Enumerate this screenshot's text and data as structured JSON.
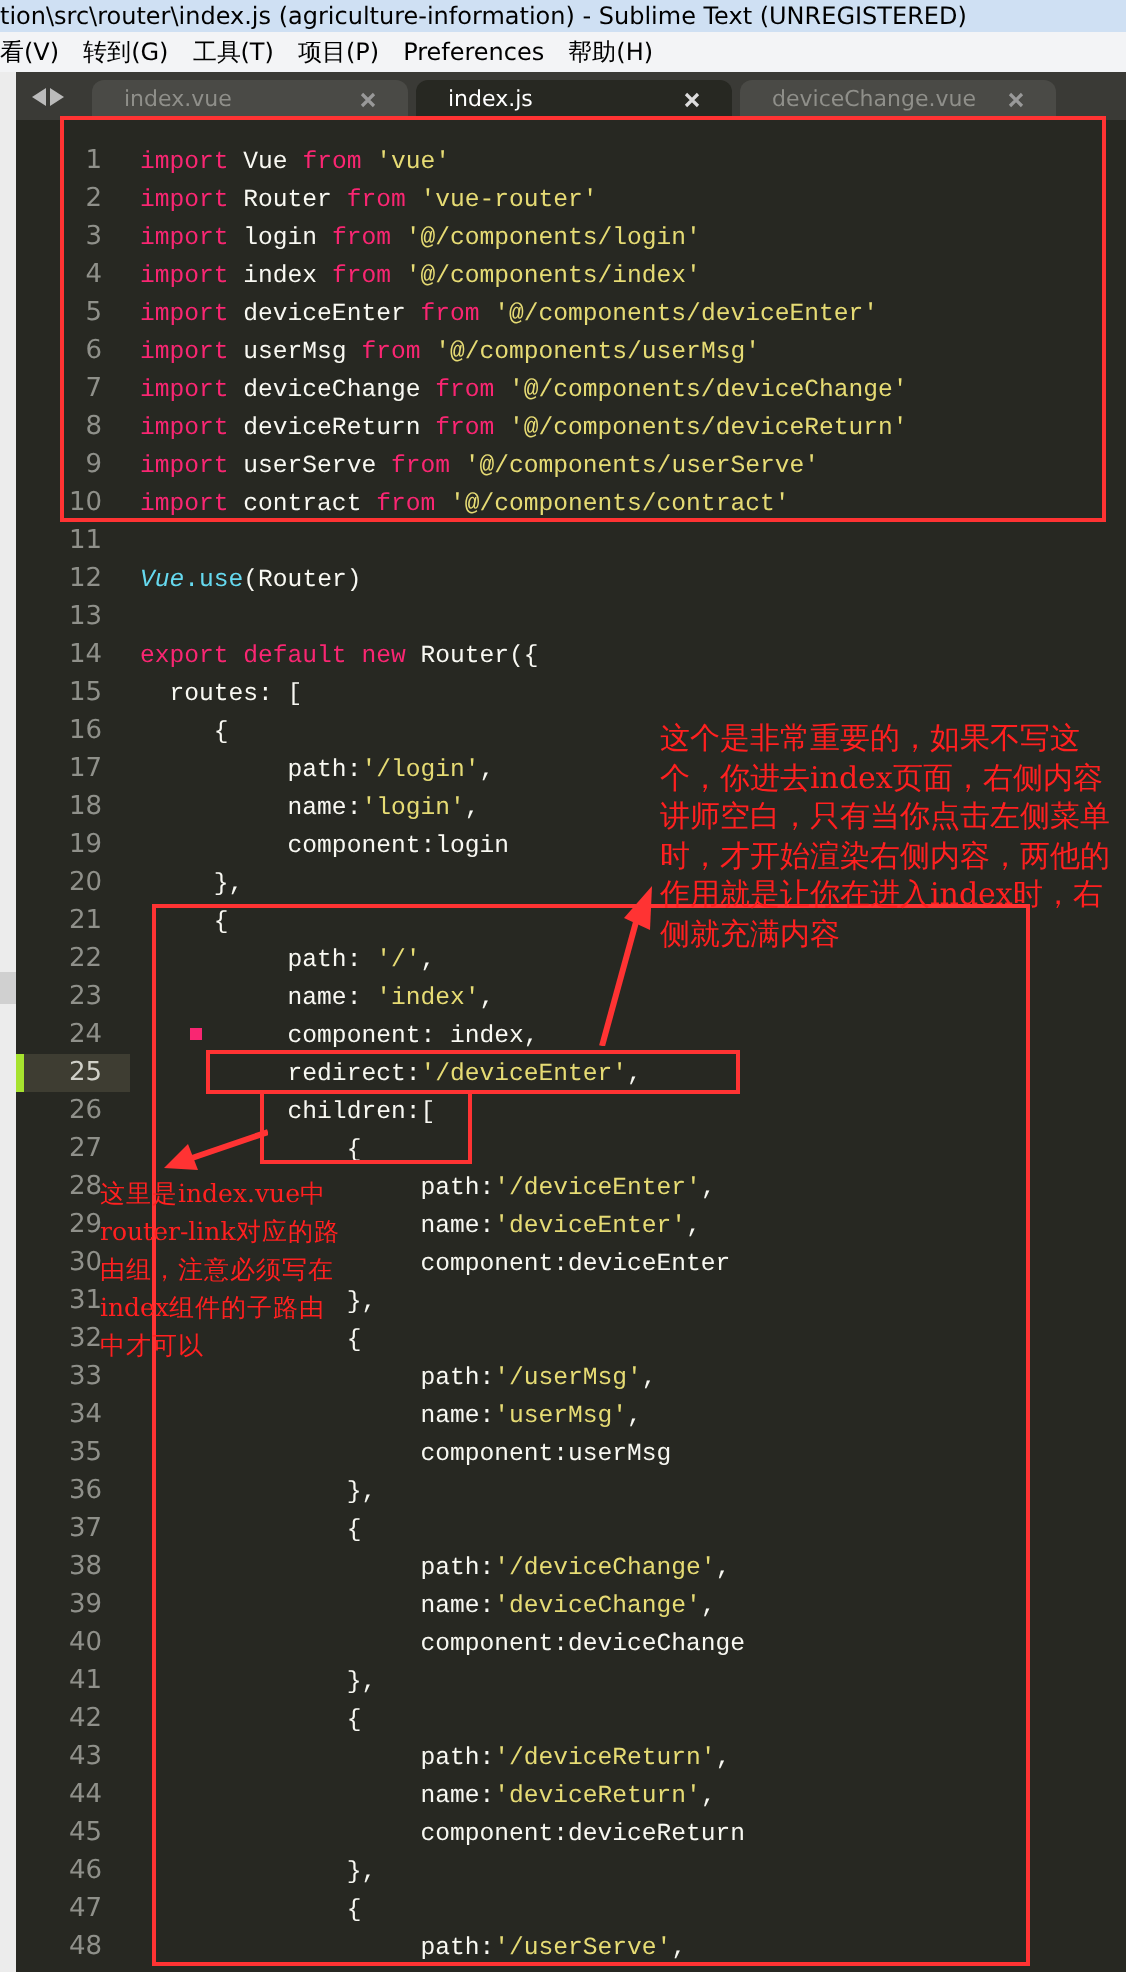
{
  "window": {
    "title": "tion\\src\\router\\index.js (agriculture-information) - Sublime Text (UNREGISTERED)"
  },
  "menu": [
    "看(V)",
    "转到(G)",
    "工具(T)",
    "项目(P)",
    "Preferences",
    "帮助(H)"
  ],
  "tabs": [
    {
      "label": "index.vue",
      "selected": false
    },
    {
      "label": "index.js",
      "selected": true
    },
    {
      "label": "deviceChange.vue",
      "selected": false
    }
  ],
  "editor": {
    "lines": [
      {
        "number": "1",
        "current": false,
        "tokens": [
          {
            "kind": "kw",
            "text": "import"
          },
          {
            "kind": "plain",
            "text": " Vue "
          },
          {
            "kind": "kw",
            "text": "from"
          },
          {
            "kind": "str",
            "text": " 'vue'"
          }
        ]
      },
      {
        "number": "2",
        "current": false,
        "tokens": [
          {
            "kind": "kw",
            "text": "import"
          },
          {
            "kind": "plain",
            "text": " Router "
          },
          {
            "kind": "kw",
            "text": "from"
          },
          {
            "kind": "str",
            "text": " 'vue-router'"
          }
        ]
      },
      {
        "number": "3",
        "current": false,
        "tokens": [
          {
            "kind": "kw",
            "text": "import"
          },
          {
            "kind": "plain",
            "text": " login "
          },
          {
            "kind": "kw",
            "text": "from"
          },
          {
            "kind": "str",
            "text": " '@/components/login'"
          }
        ]
      },
      {
        "number": "4",
        "current": false,
        "tokens": [
          {
            "kind": "kw",
            "text": "import"
          },
          {
            "kind": "plain",
            "text": " index "
          },
          {
            "kind": "kw",
            "text": "from"
          },
          {
            "kind": "str",
            "text": " '@/components/index'"
          }
        ]
      },
      {
        "number": "5",
        "current": false,
        "tokens": [
          {
            "kind": "kw",
            "text": "import"
          },
          {
            "kind": "plain",
            "text": " deviceEnter "
          },
          {
            "kind": "kw",
            "text": "from"
          },
          {
            "kind": "str",
            "text": " '@/components/deviceEnter'"
          }
        ]
      },
      {
        "number": "6",
        "current": false,
        "tokens": [
          {
            "kind": "kw",
            "text": "import"
          },
          {
            "kind": "plain",
            "text": " userMsg "
          },
          {
            "kind": "kw",
            "text": "from"
          },
          {
            "kind": "str",
            "text": " '@/components/userMsg'"
          }
        ]
      },
      {
        "number": "7",
        "current": false,
        "tokens": [
          {
            "kind": "kw",
            "text": "import"
          },
          {
            "kind": "plain",
            "text": " deviceChange "
          },
          {
            "kind": "kw",
            "text": "from"
          },
          {
            "kind": "str",
            "text": " '@/components/deviceChange'"
          }
        ]
      },
      {
        "number": "8",
        "current": false,
        "tokens": [
          {
            "kind": "kw",
            "text": "import"
          },
          {
            "kind": "plain",
            "text": " deviceReturn "
          },
          {
            "kind": "kw",
            "text": "from"
          },
          {
            "kind": "str",
            "text": " '@/components/deviceReturn'"
          }
        ]
      },
      {
        "number": "9",
        "current": false,
        "tokens": [
          {
            "kind": "kw",
            "text": "import"
          },
          {
            "kind": "plain",
            "text": " userServe "
          },
          {
            "kind": "kw",
            "text": "from"
          },
          {
            "kind": "str",
            "text": " '@/components/userServe'"
          }
        ]
      },
      {
        "number": "10",
        "current": false,
        "tokens": [
          {
            "kind": "kw",
            "text": "import"
          },
          {
            "kind": "plain",
            "text": " contract "
          },
          {
            "kind": "kw",
            "text": "from"
          },
          {
            "kind": "str",
            "text": " '@/components/contract'"
          }
        ]
      },
      {
        "number": "11",
        "current": false
      },
      {
        "number": "12",
        "current": false,
        "tokens": [
          {
            "kind": "cls",
            "text": "Vue"
          },
          {
            "kind": "fn",
            "text": ".use"
          },
          {
            "kind": "plain",
            "text": "(Router)"
          }
        ]
      },
      {
        "number": "13",
        "current": false
      },
      {
        "number": "14",
        "current": false,
        "tokens": [
          {
            "kind": "kw",
            "text": "export default new"
          },
          {
            "kind": "plain",
            "text": " Router({"
          }
        ]
      },
      {
        "number": "15",
        "current": false,
        "tokens": [
          {
            "kind": "plain",
            "text": "  routes: ["
          }
        ]
      },
      {
        "number": "16",
        "current": false,
        "tokens": [
          {
            "kind": "plain",
            "text": "     {"
          }
        ]
      },
      {
        "number": "17",
        "current": false,
        "tokens": [
          {
            "kind": "plain",
            "text": "          path:"
          },
          {
            "kind": "str",
            "text": "'/login'"
          },
          {
            "kind": "plain",
            "text": ","
          }
        ]
      },
      {
        "number": "18",
        "current": false,
        "tokens": [
          {
            "kind": "plain",
            "text": "          name:"
          },
          {
            "kind": "str",
            "text": "'login'"
          },
          {
            "kind": "plain",
            "text": ","
          }
        ]
      },
      {
        "number": "19",
        "current": false,
        "tokens": [
          {
            "kind": "plain",
            "text": "          component:login"
          }
        ]
      },
      {
        "number": "20",
        "current": false,
        "tokens": [
          {
            "kind": "plain",
            "text": "     },"
          }
        ]
      },
      {
        "number": "21",
        "current": false,
        "tokens": [
          {
            "kind": "plain",
            "text": "     {"
          }
        ]
      },
      {
        "number": "22",
        "current": false,
        "tokens": [
          {
            "kind": "plain",
            "text": "          path: "
          },
          {
            "kind": "str",
            "text": "'/'"
          },
          {
            "kind": "plain",
            "text": ","
          }
        ]
      },
      {
        "number": "23",
        "current": false,
        "tokens": [
          {
            "kind": "plain",
            "text": "          name: "
          },
          {
            "kind": "str",
            "text": "'index'"
          },
          {
            "kind": "plain",
            "text": ","
          }
        ]
      },
      {
        "number": "24",
        "current": false,
        "tokens": [
          {
            "kind": "plain",
            "text": "          component: index,"
          }
        ]
      },
      {
        "number": "25",
        "current": true,
        "tokens": [
          {
            "kind": "plain",
            "text": "          redirect:"
          },
          {
            "kind": "str",
            "text": "'/deviceEnter'"
          },
          {
            "kind": "plain",
            "text": ","
          }
        ]
      },
      {
        "number": "26",
        "current": false,
        "tokens": [
          {
            "kind": "plain",
            "text": "          children:["
          }
        ]
      },
      {
        "number": "27",
        "current": false,
        "tokens": [
          {
            "kind": "plain",
            "text": "              {"
          }
        ]
      },
      {
        "number": "28",
        "current": false,
        "tokens": [
          {
            "kind": "plain",
            "text": "                   path:"
          },
          {
            "kind": "str",
            "text": "'/deviceEnter'"
          },
          {
            "kind": "plain",
            "text": ","
          }
        ]
      },
      {
        "number": "29",
        "current": false,
        "tokens": [
          {
            "kind": "plain",
            "text": "                   name:"
          },
          {
            "kind": "str",
            "text": "'deviceEnter'"
          },
          {
            "kind": "plain",
            "text": ","
          }
        ]
      },
      {
        "number": "30",
        "current": false,
        "tokens": [
          {
            "kind": "plain",
            "text": "                   component:deviceEnter"
          }
        ]
      },
      {
        "number": "31",
        "current": false,
        "tokens": [
          {
            "kind": "plain",
            "text": "              },"
          }
        ]
      },
      {
        "number": "32",
        "current": false,
        "tokens": [
          {
            "kind": "plain",
            "text": "              {"
          }
        ]
      },
      {
        "number": "33",
        "current": false,
        "tokens": [
          {
            "kind": "plain",
            "text": "                   path:"
          },
          {
            "kind": "str",
            "text": "'/userMsg'"
          },
          {
            "kind": "plain",
            "text": ","
          }
        ]
      },
      {
        "number": "34",
        "current": false,
        "tokens": [
          {
            "kind": "plain",
            "text": "                   name:"
          },
          {
            "kind": "str",
            "text": "'userMsg'"
          },
          {
            "kind": "plain",
            "text": ","
          }
        ]
      },
      {
        "number": "35",
        "current": false,
        "tokens": [
          {
            "kind": "plain",
            "text": "                   component:userMsg"
          }
        ]
      },
      {
        "number": "36",
        "current": false,
        "tokens": [
          {
            "kind": "plain",
            "text": "              },"
          }
        ]
      },
      {
        "number": "37",
        "current": false,
        "tokens": [
          {
            "kind": "plain",
            "text": "              {"
          }
        ]
      },
      {
        "number": "38",
        "current": false,
        "tokens": [
          {
            "kind": "plain",
            "text": "                   path:"
          },
          {
            "kind": "str",
            "text": "'/deviceChange'"
          },
          {
            "kind": "plain",
            "text": ","
          }
        ]
      },
      {
        "number": "39",
        "current": false,
        "tokens": [
          {
            "kind": "plain",
            "text": "                   name:"
          },
          {
            "kind": "str",
            "text": "'deviceChange'"
          },
          {
            "kind": "plain",
            "text": ","
          }
        ]
      },
      {
        "number": "40",
        "current": false,
        "tokens": [
          {
            "kind": "plain",
            "text": "                   component:deviceChange"
          }
        ]
      },
      {
        "number": "41",
        "current": false,
        "tokens": [
          {
            "kind": "plain",
            "text": "              },"
          }
        ]
      },
      {
        "number": "42",
        "current": false,
        "tokens": [
          {
            "kind": "plain",
            "text": "              {"
          }
        ]
      },
      {
        "number": "43",
        "current": false,
        "tokens": [
          {
            "kind": "plain",
            "text": "                   path:"
          },
          {
            "kind": "str",
            "text": "'/deviceReturn'"
          },
          {
            "kind": "plain",
            "text": ","
          }
        ]
      },
      {
        "number": "44",
        "current": false,
        "tokens": [
          {
            "kind": "plain",
            "text": "                   name:"
          },
          {
            "kind": "str",
            "text": "'deviceReturn'"
          },
          {
            "kind": "plain",
            "text": ","
          }
        ]
      },
      {
        "number": "45",
        "current": false,
        "tokens": [
          {
            "kind": "plain",
            "text": "                   component:deviceReturn"
          }
        ]
      },
      {
        "number": "46",
        "current": false,
        "tokens": [
          {
            "kind": "plain",
            "text": "              },"
          }
        ]
      },
      {
        "number": "47",
        "current": false,
        "tokens": [
          {
            "kind": "plain",
            "text": "              {"
          }
        ]
      },
      {
        "number": "48",
        "current": false,
        "tokens": [
          {
            "kind": "plain",
            "text": "                   path:"
          },
          {
            "kind": "str",
            "text": "'/userServe'"
          },
          {
            "kind": "plain",
            "text": ","
          }
        ]
      }
    ]
  },
  "annotations": [
    {
      "text": "这个是非常重要的，如果不写这个，你进去index页面，右侧内容讲师空白，只有当你点击左侧菜单时，才开始渲染右侧内容，两他的作用就是让你在进入index时，右侧就充满内容"
    },
    {
      "text": "这里是index.vue中router-link对应的路由组，注意必须写在index组件的子路由中才可以"
    }
  ]
}
